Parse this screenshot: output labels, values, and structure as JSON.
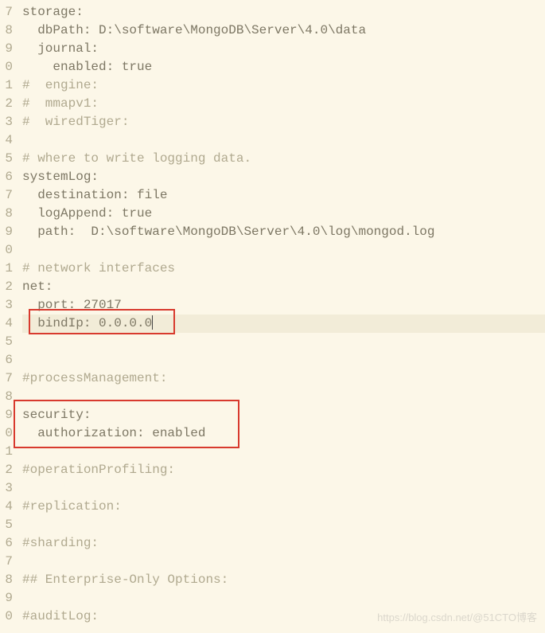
{
  "gutter": [
    "7",
    "8",
    "9",
    "0",
    "1",
    "2",
    "3",
    "4",
    "5",
    "6",
    "7",
    "8",
    "9",
    "0",
    "1",
    "2",
    "3",
    "4",
    "5",
    "6",
    "7",
    "8",
    "9",
    "0",
    "1",
    "2",
    "3",
    "4",
    "5",
    "6",
    "7",
    "8",
    "9",
    "0"
  ],
  "code": {
    "l0": "storage:",
    "l1": "  dbPath: D:\\software\\MongoDB\\Server\\4.0\\data",
    "l2": "  journal:",
    "l3": "    enabled: true",
    "l4": "#  engine:",
    "l5": "#  mmapv1:",
    "l6": "#  wiredTiger:",
    "l7": "",
    "l8": "# where to write logging data.",
    "l9": "systemLog:",
    "l10": "  destination: file",
    "l11": "  logAppend: true",
    "l12": "  path:  D:\\software\\MongoDB\\Server\\4.0\\log\\mongod.log",
    "l13": "",
    "l14": "# network interfaces",
    "l15": "net:",
    "l16": "  port: 27017",
    "l17": "  bindIp: 0.0.0.0",
    "l18": "",
    "l19": "",
    "l20": "#processManagement:",
    "l21": "",
    "l22": "security:",
    "l23": "  authorization: enabled",
    "l24": "",
    "l25": "#operationProfiling:",
    "l26": "",
    "l27": "#replication:",
    "l28": "",
    "l29": "#sharding:",
    "l30": "",
    "l31": "## Enterprise-Only Options:",
    "l32": "",
    "l33": "#auditLog:"
  },
  "watermark": "https://blog.csdn.net/@51CTO博客"
}
